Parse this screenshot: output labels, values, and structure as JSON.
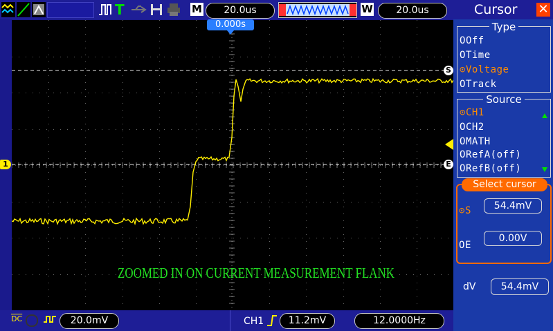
{
  "top_bar": {
    "timebase": "20.0us",
    "m_tag": "M",
    "w_tag": "W",
    "window_timebase": "20.0us",
    "trigger_mode_icon": "T",
    "trigger_position": "0.000s"
  },
  "screen": {
    "annotation": "ZOOMED IN ON CURRENT MEASUREMENT FLANK",
    "channel_marker": "1",
    "cursor_s_marker": "S",
    "cursor_e_marker": "E",
    "trace_color": "#ffee00"
  },
  "bottom_bar": {
    "coupling": "DC",
    "volts_div": "20.0mV",
    "trigger_source": "CH1",
    "trigger_level": "11.2mV",
    "frequency": "12.0000Hz"
  },
  "cursor_panel": {
    "title": "Cursor",
    "type_label": "Type",
    "type_options": [
      "Off",
      "Time",
      "Voltage",
      "Track"
    ],
    "type_selected": "Voltage",
    "source_label": "Source",
    "source_options": [
      "CH1",
      "CH2",
      "MATH",
      "RefA(off)",
      "RefB(off)"
    ],
    "source_selected": "CH1",
    "select_label": "Select cursor",
    "s_label": "S",
    "s_value": "54.4mV",
    "e_label": "E",
    "e_value": "0.00V",
    "dv_label": "dV",
    "dv_value": "54.4mV"
  }
}
